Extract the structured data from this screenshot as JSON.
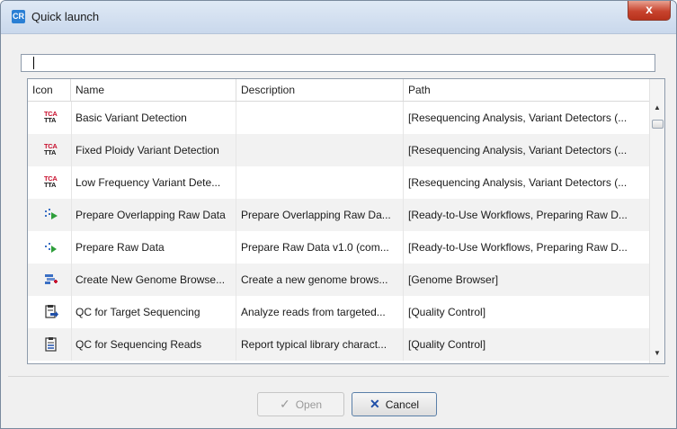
{
  "window": {
    "title": "Quick launch",
    "app_icon_text": "CR",
    "close_symbol": "x"
  },
  "search": {
    "value": "",
    "placeholder": ""
  },
  "table": {
    "headers": {
      "icon": "Icon",
      "name": "Name",
      "description": "Description",
      "path": "Path"
    },
    "rows": [
      {
        "icon": "tca-tta-icon",
        "name": "Basic Variant Detection",
        "description": "",
        "path": "[Resequencing Analysis, Variant Detectors (..."
      },
      {
        "icon": "tca-tta-icon",
        "name": "Fixed Ploidy Variant Detection",
        "description": "",
        "path": "[Resequencing Analysis, Variant Detectors (..."
      },
      {
        "icon": "tca-tta-icon",
        "name": "Low Frequency Variant Dete...",
        "description": "",
        "path": "[Resequencing Analysis, Variant Detectors (..."
      },
      {
        "icon": "workflow-icon",
        "name": "Prepare Overlapping Raw Data",
        "description": "Prepare Overlapping Raw Da...",
        "path": "[Ready-to-Use Workflows, Preparing Raw D..."
      },
      {
        "icon": "workflow-icon",
        "name": "Prepare Raw Data",
        "description": "Prepare Raw Data v1.0 (com...",
        "path": "[Ready-to-Use Workflows, Preparing Raw D..."
      },
      {
        "icon": "genome-browser-icon",
        "name": "Create New Genome Browse...",
        "description": "Create a new genome brows...",
        "path": "[Genome Browser]"
      },
      {
        "icon": "qc-report-icon",
        "name": "QC for Target Sequencing",
        "description": "Analyze reads from targeted...",
        "path": "[Quality Control]"
      },
      {
        "icon": "qc-report-icon",
        "name": "QC for Sequencing Reads",
        "description": "Report typical library charact...",
        "path": "[Quality Control]"
      }
    ]
  },
  "scrollbar": {
    "up_symbol": "▲",
    "down_symbol": "▼"
  },
  "buttons": {
    "open": {
      "label": "Open",
      "icon_symbol": "✓",
      "enabled": false
    },
    "cancel": {
      "label": "Cancel",
      "icon_symbol": "✕",
      "enabled": true
    }
  },
  "colors": {
    "accent": "#2a7fd4",
    "close_red": "#c7432e",
    "tca_red": "#c8102e",
    "workflow_green": "#2e9e3a",
    "cancel_blue": "#1f4fa8"
  }
}
